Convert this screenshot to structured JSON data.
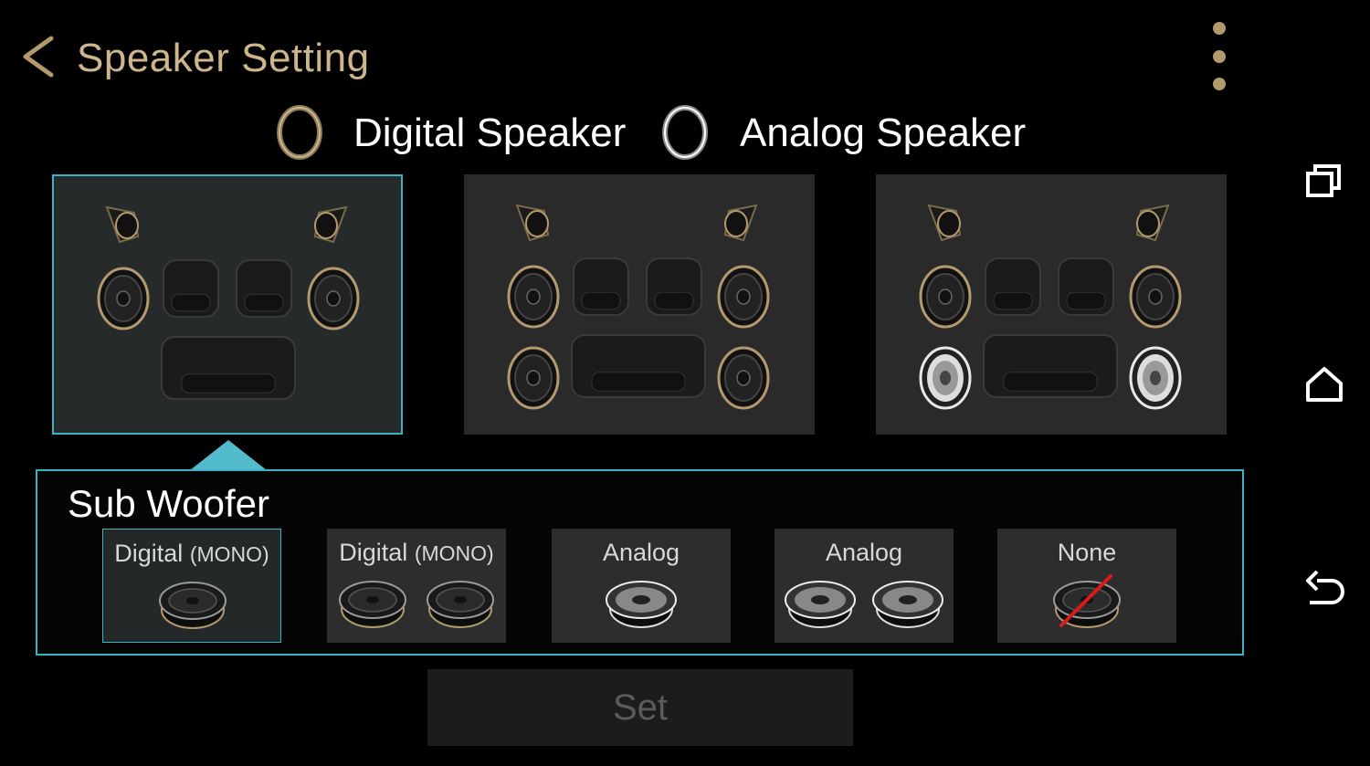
{
  "header": {
    "title": "Speaker Setting"
  },
  "legend": {
    "digital": "Digital Speaker",
    "analog": "Analog Speaker"
  },
  "subwoofer": {
    "title": "Sub Woofer",
    "options": [
      {
        "label": "Digital",
        "suffix": "(MONO)"
      },
      {
        "label": "Digital",
        "suffix": "(MONO)"
      },
      {
        "label": "Analog",
        "suffix": ""
      },
      {
        "label": "Analog",
        "suffix": ""
      },
      {
        "label": "None",
        "suffix": ""
      }
    ]
  },
  "set_button": {
    "label": "Set"
  },
  "colors": {
    "accent": "#3ab4c4",
    "title": "#cdb58c",
    "gold": "#b39a6e"
  },
  "icons": [
    "back-arrow-icon",
    "overflow-menu-icon",
    "recent-apps-icon",
    "home-icon",
    "back-nav-icon"
  ]
}
